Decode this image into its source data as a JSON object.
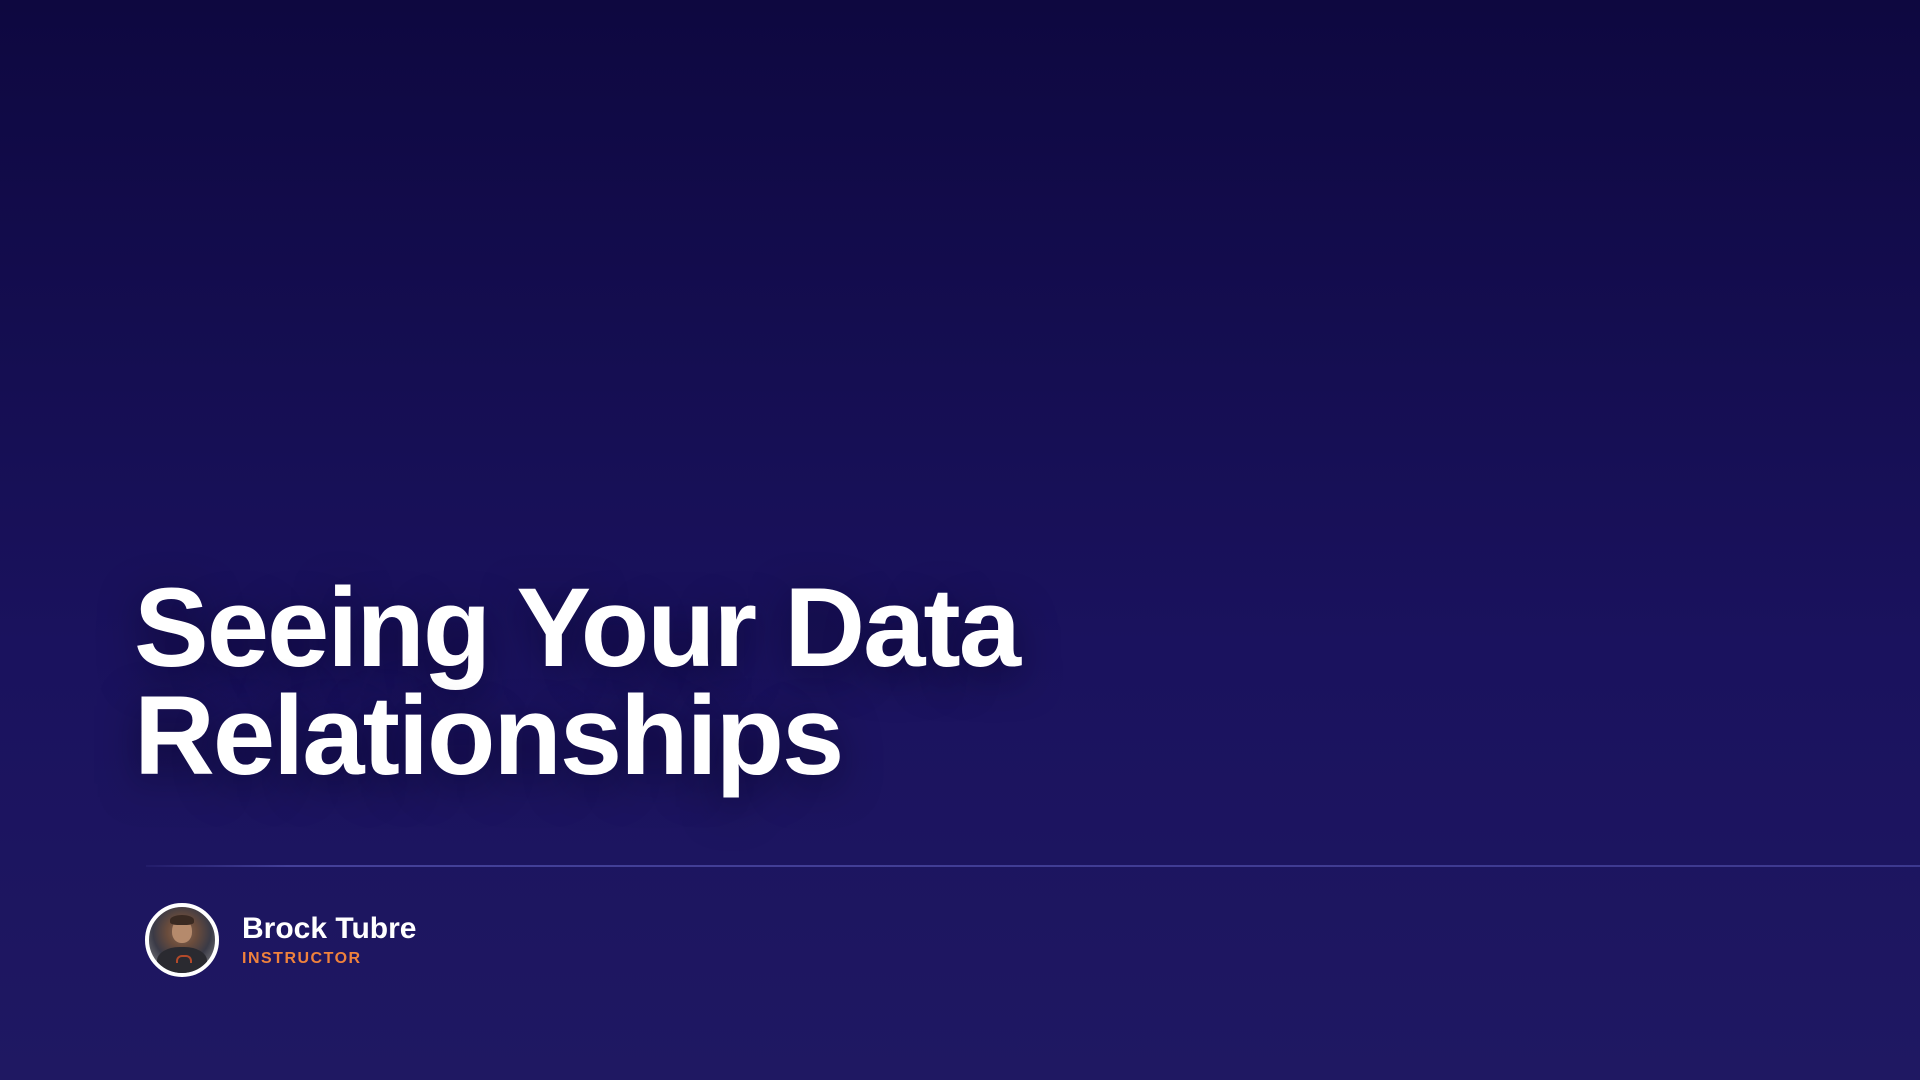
{
  "slide": {
    "title_lines": [
      "Seeing Your Data",
      "Relationships"
    ]
  },
  "instructor": {
    "name": "Brock Tubre",
    "role": "INSTRUCTOR"
  },
  "colors": {
    "background_top": "#0e0840",
    "background_bottom": "#1f1862",
    "title_text": "#ffffff",
    "role_accent": "#f0823c",
    "divider": "#6464c8"
  },
  "icons": {
    "avatar": "instructor-avatar-photo"
  }
}
